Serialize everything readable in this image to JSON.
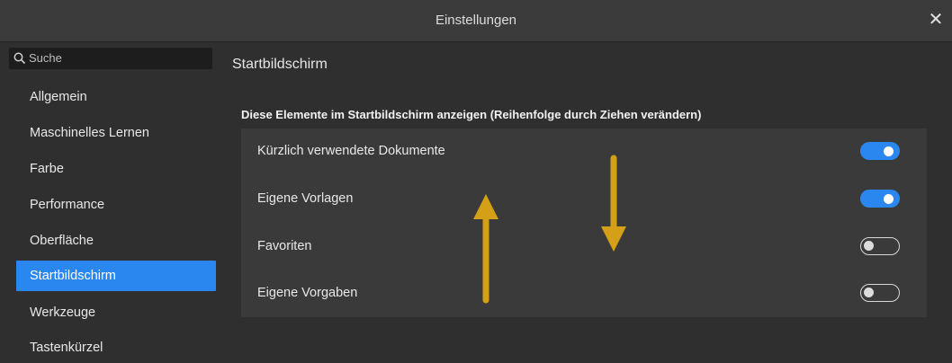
{
  "window": {
    "title": "Einstellungen",
    "close_glyph": "✕"
  },
  "sidebar": {
    "search_placeholder": "Suche",
    "items": [
      {
        "label": "Allgemein",
        "active": false
      },
      {
        "label": "Maschinelles Lernen",
        "active": false
      },
      {
        "label": "Farbe",
        "active": false
      },
      {
        "label": "Performance",
        "active": false
      },
      {
        "label": "Oberfläche",
        "active": false
      },
      {
        "label": "Startbildschirm",
        "active": true
      },
      {
        "label": "Werkzeuge",
        "active": false
      },
      {
        "label": "Tastenkürzel",
        "active": false
      }
    ]
  },
  "main": {
    "section_title": "Startbildschirm",
    "hint": "Diese Elemente im Startbildschirm anzeigen (Reihenfolge durch Ziehen verändern)",
    "rows": [
      {
        "label": "Kürzlich verwendete Dokumente",
        "enabled": true
      },
      {
        "label": "Eigene Vorlagen",
        "enabled": true
      },
      {
        "label": "Favoriten",
        "enabled": false
      },
      {
        "label": "Eigene Vorgaben",
        "enabled": false
      }
    ]
  },
  "colors": {
    "accent": "#2a87f0",
    "annotation_arrow": "#d4a017",
    "background": "#2f2f2f"
  },
  "icons": {
    "search": "search-icon",
    "close": "close-icon",
    "up": "arrow-up-icon",
    "down": "arrow-down-icon"
  }
}
